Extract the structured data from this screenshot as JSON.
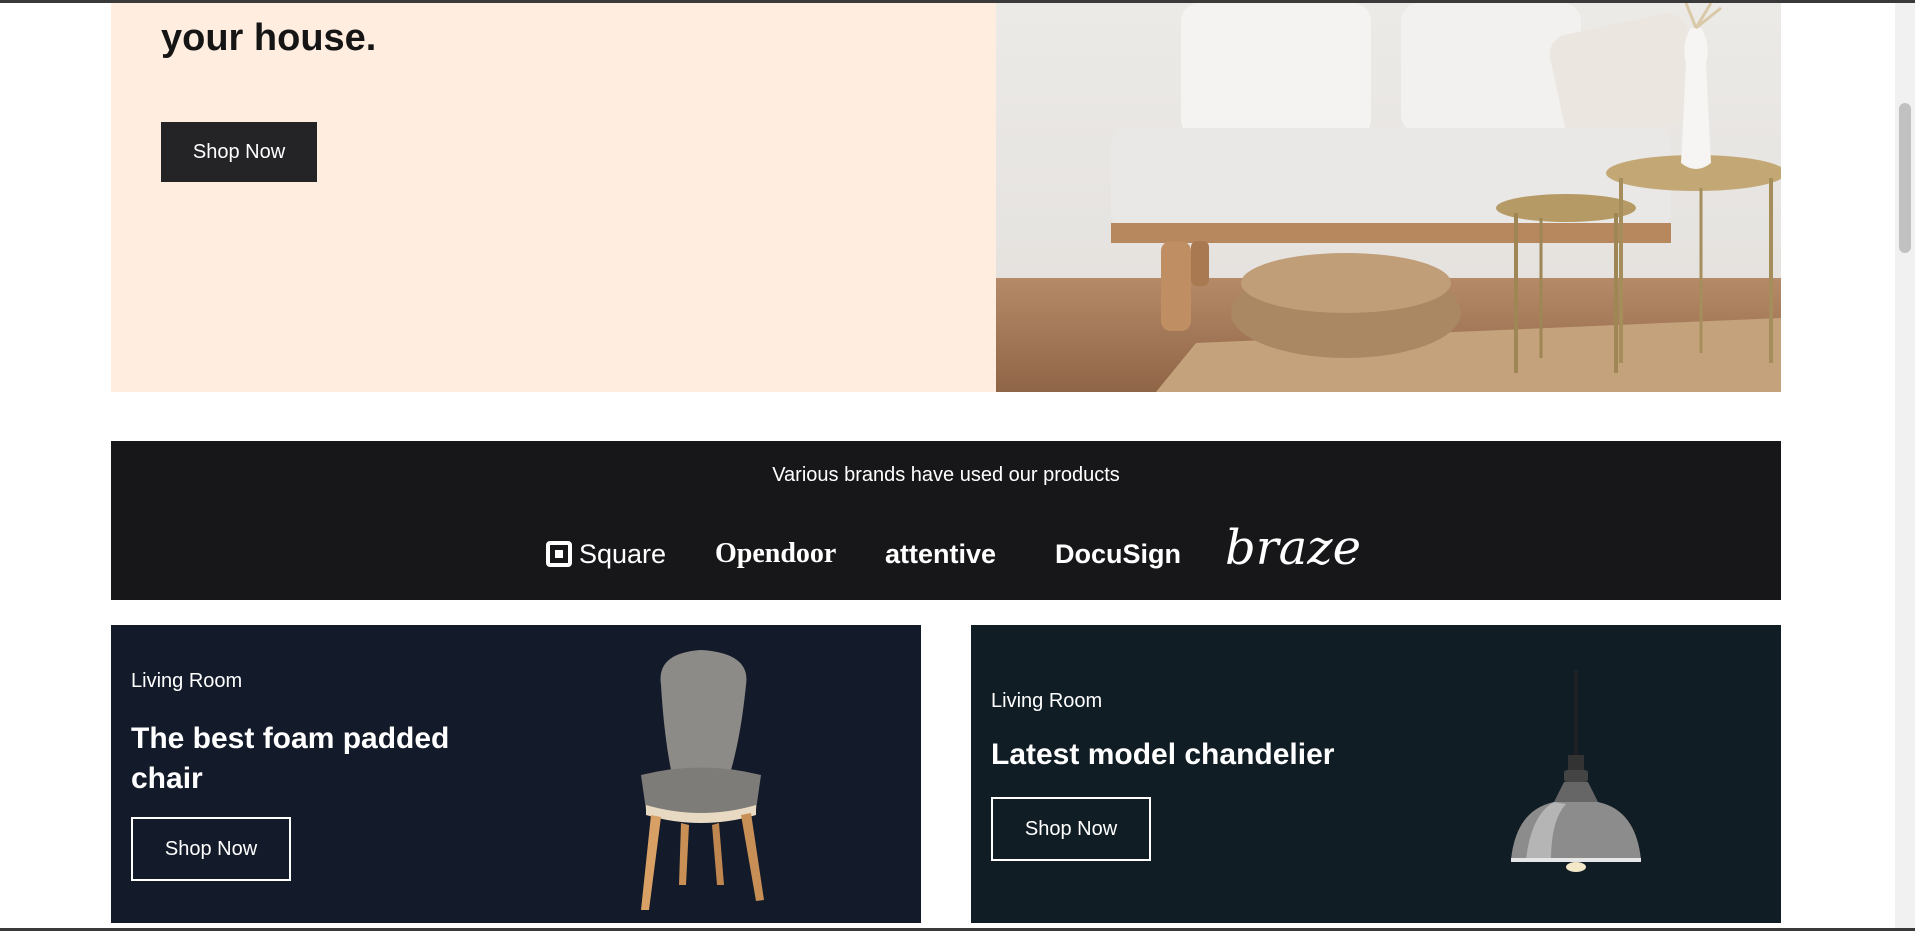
{
  "hero": {
    "title_fragment": "your house.",
    "cta_label": "Shop Now"
  },
  "brands": {
    "heading": "Various brands have used our products",
    "logos": [
      {
        "name": "Square",
        "icon": "square-logo-icon"
      },
      {
        "name": "Opendoor"
      },
      {
        "name": "attentive"
      },
      {
        "name": "DocuSign"
      },
      {
        "name": "braze"
      }
    ]
  },
  "promos": [
    {
      "category": "Living Room",
      "title": "The best foam padded chair",
      "cta_label": "Shop Now",
      "image_icon": "chair-image",
      "bg_color": "#131a29"
    },
    {
      "category": "Living Room",
      "title": "Latest model chandelier",
      "cta_label": "Shop Now",
      "image_icon": "pendant-lamp-image",
      "bg_color": "#111d25"
    }
  ],
  "colors": {
    "hero_bg": "#ffede0",
    "dark_button": "#242426",
    "brand_bar": "#171719"
  }
}
